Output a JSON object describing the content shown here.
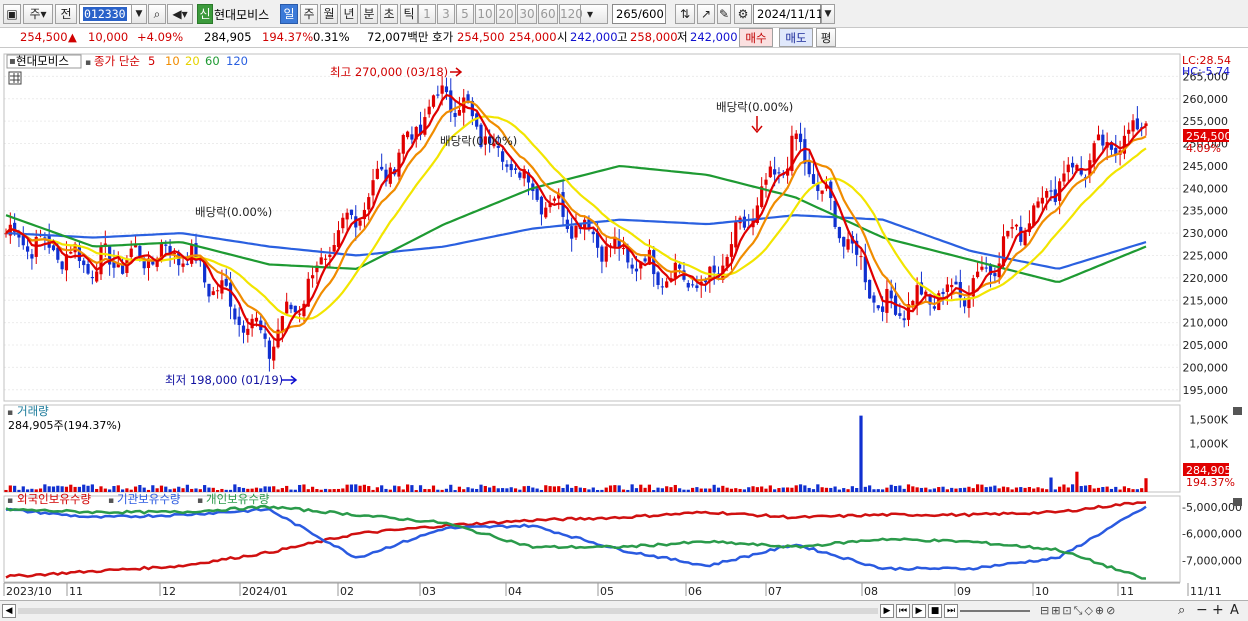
{
  "toolbar": {
    "menu_label": "주",
    "type_label": "전",
    "code": "012330",
    "stock_name": "현대모비스",
    "badge": "신",
    "periods": [
      "일",
      "주",
      "월",
      "년",
      "분",
      "초",
      "틱"
    ],
    "numbers": [
      "1",
      "3",
      "5",
      "10",
      "20",
      "30",
      "60",
      "120"
    ],
    "count": "265",
    "count_max": "600",
    "date": "2024/11/11"
  },
  "quote": {
    "price": "254,500",
    "change": "10,000",
    "change_pct": "+4.09%",
    "volume": "284,905",
    "volume_pct": "194.37%",
    "turnover": "0.31%",
    "amount": "72,007백만",
    "ask_label": "호가",
    "ask": "254,500",
    "bid": "254,000",
    "open_label": "시",
    "open": "242,000",
    "high_label": "고",
    "high": "258,000",
    "low_label": "저",
    "low": "242,000",
    "buy": "매수",
    "sell": "매도",
    "eval": "평"
  },
  "price_panel": {
    "title": "현대모비스",
    "legend_text": "종가 단순",
    "mas": [
      "5",
      "10",
      "20",
      "60",
      "120"
    ],
    "lc": "LC:28.54",
    "hc": "HC:-5.74",
    "current": "254,500",
    "current_pct": "4.09%",
    "high_note": "최고 270,000 (03/18)",
    "low_note": "최저 198,000 (01/19)",
    "div1": "배당락(0.00%)",
    "div2": "배당락(0.00%)",
    "div3": "배당락(0.00%)"
  },
  "volume_panel": {
    "title": "거래량",
    "info": "284,905주(194.37%)",
    "current": "284,905",
    "current_pct": "194.37%"
  },
  "holdings_panel": {
    "s1": "외국인보유수량",
    "s2": "기관보유수량",
    "s3": "개인보유수량"
  },
  "x_axis": {
    "labels": [
      "2023/10",
      "11",
      "12",
      "2024/01",
      "02",
      "03",
      "04",
      "05",
      "06",
      "07",
      "08",
      "09",
      "10",
      "11",
      "11/11"
    ]
  },
  "colors": {
    "up": "#e00000",
    "down": "#1030d0",
    "ma5": "#e00000",
    "ma10": "#f08c00",
    "ma20": "#f2e500",
    "ma60": "#1e9a32",
    "ma120": "#2a60e0"
  },
  "chart_data": {
    "type": "line",
    "title": "현대모비스",
    "price_axis": {
      "ylim": [
        192500,
        270000
      ],
      "ticks": [
        195000,
        200000,
        205000,
        210000,
        215000,
        220000,
        225000,
        230000,
        235000,
        240000,
        245000,
        250000,
        255000,
        260000,
        265000
      ]
    },
    "volume_axis": {
      "ylim": [
        0,
        1800
      ],
      "ticks": [
        "1,500K",
        "1,000K",
        "500K"
      ],
      "tick_values": [
        1500,
        1000,
        500
      ]
    },
    "holdings_axis": {
      "ylim": [
        -7800000,
        -4600000
      ],
      "ticks": [
        "-5,000,000",
        "-6,000,000",
        "-7,000,000"
      ],
      "tick_values": [
        -5000000,
        -6000000,
        -7000000
      ]
    },
    "x": [
      "2023-10",
      "2023-11",
      "2023-12",
      "2024-01",
      "2024-02",
      "2024-03",
      "2024-04",
      "2024-05",
      "2024-06",
      "2024-07",
      "2024-08",
      "2024-09",
      "2024-10",
      "2024-11"
    ],
    "close_monthly": [
      230000,
      223000,
      226000,
      205000,
      235000,
      262000,
      240000,
      225000,
      218000,
      250000,
      213000,
      218000,
      242000,
      254500
    ],
    "ma120_monthly": [
      230000,
      229000,
      230000,
      227000,
      225000,
      227000,
      231000,
      233000,
      232000,
      234000,
      233000,
      226000,
      222000,
      228000
    ],
    "ma60_monthly": [
      234000,
      227000,
      228000,
      223000,
      222000,
      232000,
      240000,
      245000,
      243000,
      238000,
      229000,
      224000,
      219000,
      227000
    ],
    "series": [
      {
        "name": "외국인보유수량",
        "values": [
          -7600000,
          -7400000,
          -7200000,
          -6700000,
          -6000000,
          -5700000,
          -5500000,
          -5400000,
          -5200000,
          -5400000,
          -5300000,
          -5300000,
          -5200000,
          -4800000
        ]
      },
      {
        "name": "기관보유수량",
        "values": [
          -5100000,
          -5400000,
          -5300000,
          -5100000,
          -6900000,
          -5800000,
          -5700000,
          -6600000,
          -7200000,
          -6400000,
          -7300000,
          -7300000,
          -6900000,
          -5000000
        ]
      },
      {
        "name": "개인보유수량",
        "values": [
          -5100000,
          -5200000,
          -5200000,
          -5000000,
          -5300000,
          -5600000,
          -6500000,
          -6500000,
          -6300000,
          -6500000,
          -6200000,
          -6300000,
          -6600000,
          -7700000
        ]
      }
    ]
  }
}
